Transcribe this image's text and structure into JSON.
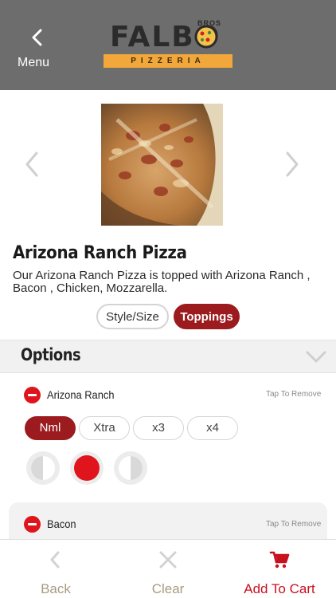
{
  "header": {
    "menu_label": "Menu",
    "logo_word": "FALBO",
    "logo_small": "BROS",
    "logo_banner": "PIZZERIA"
  },
  "product": {
    "title": "Arizona Ranch Pizza",
    "description": "Our Arizona Ranch Pizza is topped with Arizona Ranch , Bacon , Chicken, Mozzarella."
  },
  "segments": {
    "style_size": "Style/Size",
    "toppings": "Toppings",
    "active": "Toppings"
  },
  "options": {
    "title": "Options",
    "toppings": [
      {
        "name": "Arizona Ranch",
        "action": "Tap To Remove",
        "quantities": [
          "Nml",
          "Xtra",
          "x3",
          "x4"
        ],
        "selected_quantity": "Nml",
        "placement": "whole"
      },
      {
        "name": "Bacon",
        "action": "Tap To Remove"
      }
    ]
  },
  "bottom_bar": {
    "back": "Back",
    "clear": "Clear",
    "add_to_cart": "Add To Cart"
  },
  "colors": {
    "header_bg": "#6d6d6d",
    "accent_red": "#9c1b1f",
    "cart_red": "#c8101f",
    "minus_red": "#e0141c",
    "banner_orange": "#f2a73a"
  }
}
